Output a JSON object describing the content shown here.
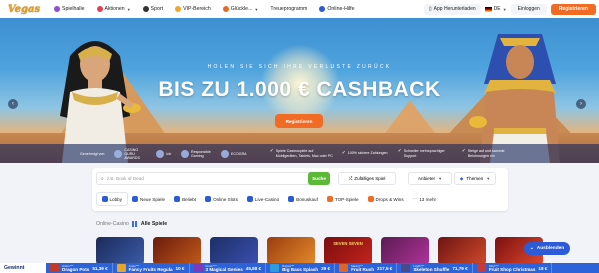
{
  "brand": {
    "logo_text": "Vegas",
    "accent": "#f26b24",
    "green": "#5cb839",
    "blue": "#2d63d9"
  },
  "nav": {
    "items": [
      {
        "label": "Spielhalle",
        "icon": "slot-icon"
      },
      {
        "label": "Aktionen",
        "icon": "gift-icon",
        "has_dropdown": true
      },
      {
        "label": "Sport",
        "icon": "football-icon"
      },
      {
        "label": "VIP-Bereich",
        "icon": "crown-icon"
      },
      {
        "label": "Glückle...",
        "icon": "wheel-icon",
        "has_dropdown": true
      },
      {
        "label": "Treueprogramm",
        "icon": ""
      },
      {
        "label": "Online-Hilfe",
        "icon": "chat-icon"
      }
    ],
    "app_button": "App Herunterladen",
    "language": "DE",
    "login": "Einloggen",
    "register": "Registrieren"
  },
  "hero": {
    "subtitle": "HOLEN SIE SICH IHRE VERLUSTE ZURÜCK",
    "title": "BIS ZU 1.000 € CASHBACK",
    "cta": "Registrieren",
    "badges": [
      {
        "label": "Genehmigt von"
      },
      {
        "label": "CASINO GURU AWARDS"
      },
      {
        "label": "icb"
      },
      {
        "label": "Responsible Gaming"
      },
      {
        "label": "ECOGRA"
      }
    ],
    "features": [
      "Spiele Casinospiele auf Mobilgeräten, Tablets, Mac oder PC",
      "100% sichere Zahlungen",
      "Schneller mehrsprachiger Support",
      "Steige auf und sammle Belohnungen ein"
    ]
  },
  "search": {
    "placeholder": "z.B. Book of Dead",
    "button": "Suche",
    "random": "Zufälliges Spiel",
    "providers": "Anbieter",
    "themes": "Themen"
  },
  "categories": [
    {
      "label": "Lobby",
      "icon": "lobby-icon",
      "color": "#2b5bd7",
      "active": true
    },
    {
      "label": "Neue Spiele",
      "icon": "new-icon",
      "color": "#2b5bd7"
    },
    {
      "label": "Beliebt",
      "icon": "star-icon",
      "color": "#2b5bd7"
    },
    {
      "label": "Online Slots",
      "icon": "slot-icon",
      "color": "#2b5bd7"
    },
    {
      "label": "Live-Casino",
      "icon": "live-icon",
      "color": "#2b5bd7"
    },
    {
      "label": "Bonuskauf",
      "icon": "bonus-icon",
      "color": "#2b5bd7"
    },
    {
      "label": "TOP-Spiele",
      "icon": "top-icon",
      "color": "#f26b24"
    },
    {
      "label": "Drops & Wins",
      "icon": "drops-icon",
      "color": "#f26b24"
    },
    {
      "label": "13 mehr",
      "icon": "more-icon",
      "color": "#555555"
    }
  ],
  "section": {
    "crumb": "Online-Casino",
    "title": "Alle Spiele"
  },
  "tiles": [
    "",
    "",
    "",
    "",
    "SEVEN SEVEN",
    "",
    "",
    ""
  ],
  "hide_button": "Ausblenden",
  "ticker": {
    "head": "Gewinnt",
    "items": [
      {
        "user": "Antho***",
        "game": "Dragon Pots",
        "amount": "51,39 €"
      },
      {
        "user": "Justo***",
        "game": "Fancy Fruits Regula",
        "amount": "10 €"
      },
      {
        "user": "Kinen***",
        "game": "3 Magical Genies",
        "amount": "45,88 €"
      },
      {
        "user": "Rahsa***",
        "game": "Big Bass Splash",
        "amount": "29 €"
      },
      {
        "user": "Marko***",
        "game": "Fruit Rush",
        "amount": "217,5 €"
      },
      {
        "user": "Lindb***",
        "game": "Skeleton Shuffle",
        "amount": "71,79 €"
      },
      {
        "user": "Sibyl***",
        "game": "Fruit Shop Christmas",
        "amount": "18 €"
      }
    ]
  }
}
